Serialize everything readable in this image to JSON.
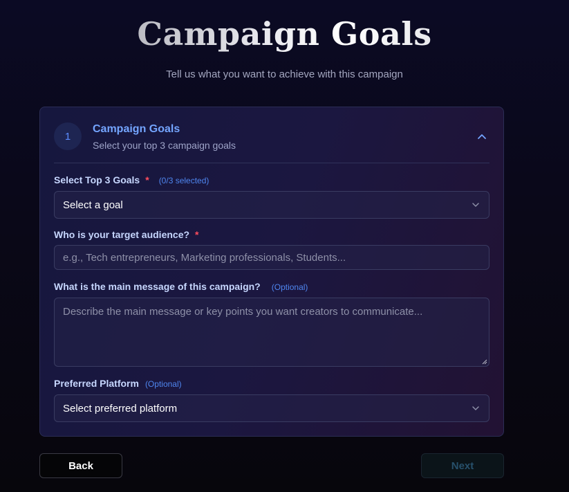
{
  "page": {
    "title": "Campaign Goals",
    "subtitle": "Tell us what you want to achieve with this campaign"
  },
  "section": {
    "step_number": "1",
    "title": "Campaign Goals",
    "subtitle": "Select your top 3 campaign goals",
    "collapse_icon": "chevron-up-icon"
  },
  "fields": {
    "goals": {
      "label": "Select Top 3 Goals",
      "required_mark": "*",
      "counter": "(0/3 selected)",
      "value": "Select a goal"
    },
    "audience": {
      "label": "Who is your target audience?",
      "required_mark": "*",
      "placeholder": "e.g., Tech entrepreneurs, Marketing professionals, Students..."
    },
    "message": {
      "label": "What is the main message of this campaign?",
      "optional": "(Optional)",
      "placeholder": "Describe the main message or key points you want creators to communicate..."
    },
    "platform": {
      "label": "Preferred Platform",
      "optional": "(Optional)",
      "value": "Select preferred platform"
    }
  },
  "buttons": {
    "back": "Back",
    "next": "Next"
  },
  "colors": {
    "accent": "#74a5ff",
    "required": "#ff4d5e",
    "hint": "#4f86f0"
  }
}
